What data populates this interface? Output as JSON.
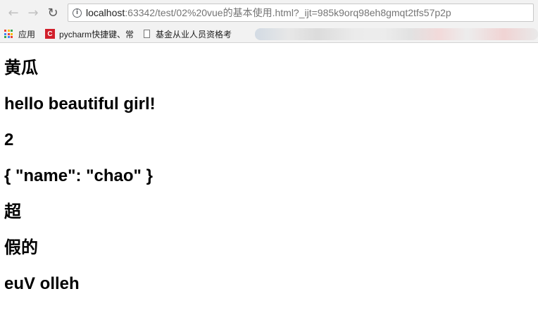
{
  "browser": {
    "back_icon": "←",
    "forward_icon": "→",
    "reload_icon": "↻",
    "info_icon": "i",
    "url_host": "localhost",
    "url_rest": ":63342/test/02%20vue的基本使用.html?_ijt=985k9orq98eh8gmqt2tfs57p2p",
    "bookmarks": {
      "apps_label": "应用",
      "pycharm_label": "pycharm快捷键、常",
      "fund_label": "基金从业人员资格考"
    },
    "apps_icon_colors": [
      "#ea4335",
      "#fbbc05",
      "#34a853",
      "#4285f4",
      "#ea4335",
      "#fbbc05",
      "#34a853",
      "#4285f4",
      "#ea4335"
    ]
  },
  "content": {
    "lines": [
      "黄瓜",
      "hello beautiful girl!",
      "2",
      "{ \"name\": \"chao\" }",
      "超",
      "假的",
      "euV olleh"
    ]
  }
}
